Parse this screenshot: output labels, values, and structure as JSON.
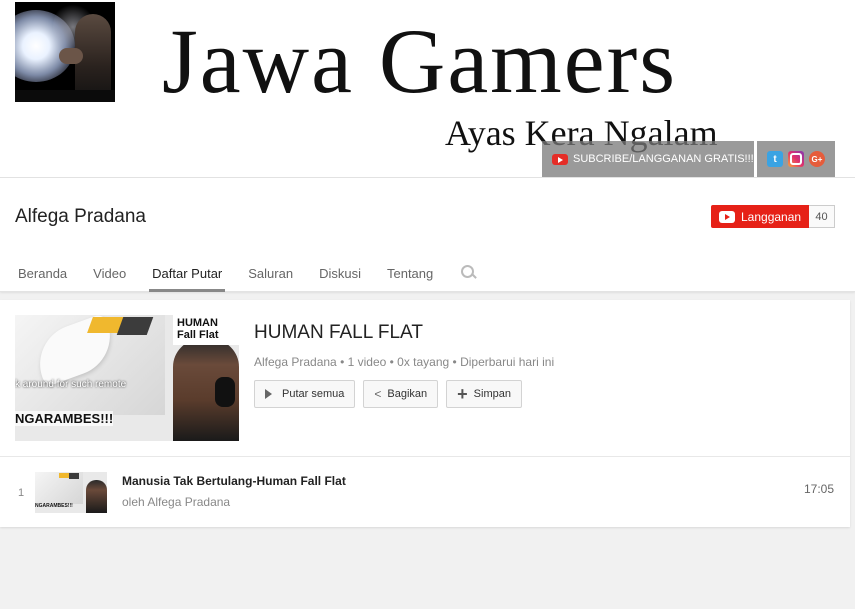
{
  "banner": {
    "title": "Jawa Gamers",
    "subtitle": "Ayas Kera Ngalam",
    "subscribe_link": "SUBCRIBE/LANGGANAN GRATIS!!!!",
    "social_icons": [
      "twitter-icon",
      "instagram-icon",
      "google-plus-icon"
    ],
    "google_plus_label": "G+"
  },
  "channel": {
    "name": "Alfega Pradana",
    "subscribe_label": "Langganan",
    "subscriber_count": "40"
  },
  "tabs": [
    {
      "label": "Beranda",
      "active": false
    },
    {
      "label": "Video",
      "active": false
    },
    {
      "label": "Daftar Putar",
      "active": true
    },
    {
      "label": "Saluran",
      "active": false
    },
    {
      "label": "Diskusi",
      "active": false
    },
    {
      "label": "Tentang",
      "active": false
    }
  ],
  "playlist": {
    "title": "HUMAN FALL FLAT",
    "meta": "Alfega Pradana • 1 video • 0x tayang • Diperbarui hari ini",
    "thumb_overlay_text": "k around for such remote",
    "thumb_big_text": "NGARAMBES!!!",
    "thumb_logo_line1": "HUMAN",
    "thumb_logo_line2": "Fall Flat",
    "actions": {
      "play_all": "Putar semua",
      "share": "Bagikan",
      "save": "Simpan"
    }
  },
  "videos": [
    {
      "index": "1",
      "title": "Manusia Tak Bertulang-Human Fall Flat",
      "by": "oleh Alfega Pradana",
      "duration": "17:05",
      "thumb_text": "NGARAMBES!!!"
    }
  ],
  "colors": {
    "youtube_red": "#e62117",
    "twitter": "#3aa3e3",
    "background": "#f1f1f1"
  }
}
